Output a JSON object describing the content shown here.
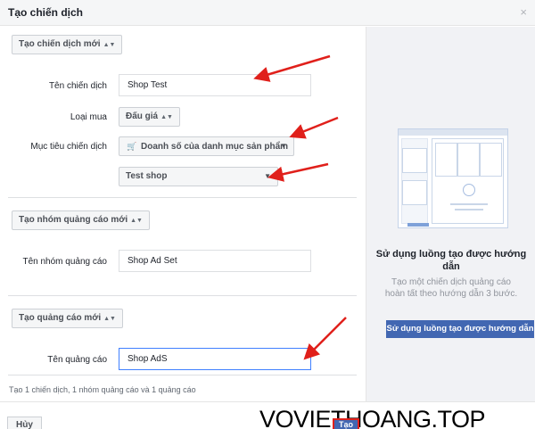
{
  "header": {
    "title": "Tạo chiến dịch",
    "close_label": "×"
  },
  "campaign": {
    "selector_label": "Tạo chiến dịch mới",
    "name_label": "Tên chiến dịch",
    "name_value": "Shop Test",
    "buy_type_label": "Loại mua",
    "buy_type_value": "Đấu giá",
    "objective_label": "Mục tiêu chiến dịch",
    "objective_value": "Doanh số của danh mục sản phẩm",
    "catalog_value": "Test shop"
  },
  "adset": {
    "selector_label": "Tạo nhóm quảng cáo mới",
    "name_label": "Tên nhóm quảng cáo",
    "name_value": "Shop Ad Set"
  },
  "ad": {
    "selector_label": "Tạo quảng cáo mới",
    "name_label": "Tên quảng cáo",
    "name_value": "Shop AdS"
  },
  "summary": "Tạo 1 chiến dịch, 1 nhóm quảng cáo và 1 quảng cáo",
  "guide": {
    "title": "Sử dụng luồng tạo được hướng dẫn",
    "description": "Tạo một chiến dịch quảng cáo hoàn tất theo hướng dẫn 3 bước.",
    "button_label": "Sử dụng luồng tạo được hướng dẫn"
  },
  "footer": {
    "cancel_label": "Hủy",
    "create_label": "Tạo",
    "watermark": "VOVIETHOANG.TOP"
  },
  "colors": {
    "primary": "#4267b2",
    "annotation": "#e0201b",
    "focus": "#4080ff"
  },
  "icons": {
    "cart": "cart-icon",
    "dropdown": "caret-down-icon",
    "close": "close-icon"
  }
}
